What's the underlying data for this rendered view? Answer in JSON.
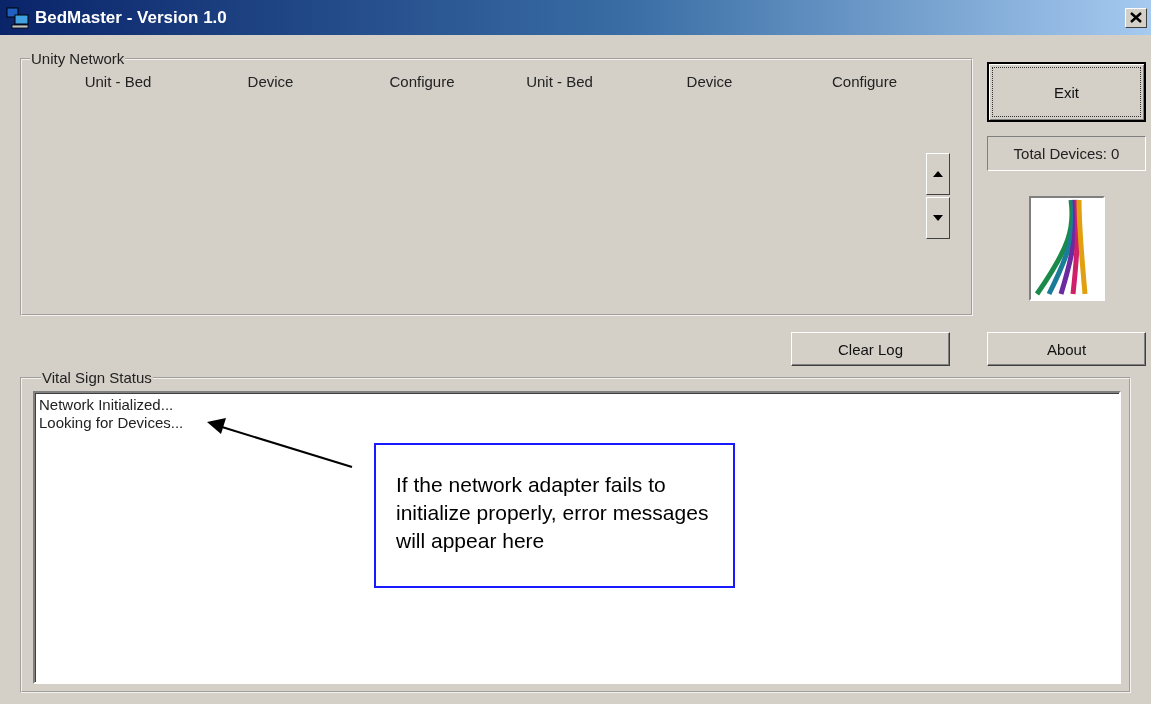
{
  "window": {
    "title": "BedMaster - Version 1.0"
  },
  "unity_network": {
    "title": "Unity Network",
    "columns": [
      "Unit - Bed",
      "Device",
      "Configure",
      "Unit - Bed",
      "Device",
      "Configure"
    ]
  },
  "buttons": [
    {
      "kind": "exit",
      "label": "Exit",
      "default": true
    },
    {
      "kind": "clear_log",
      "label": "Clear Log",
      "default": false
    },
    {
      "kind": "about",
      "label": "About",
      "default": false
    }
  ],
  "total_devices": "Total Devices: 0",
  "vital_sign_status": {
    "title": "Vital Sign Status",
    "log": [
      "Network Initialized...",
      "Looking for Devices..."
    ]
  },
  "callout": {
    "text": "If the network adapter fails to initialize properly, error messages will appear here"
  }
}
